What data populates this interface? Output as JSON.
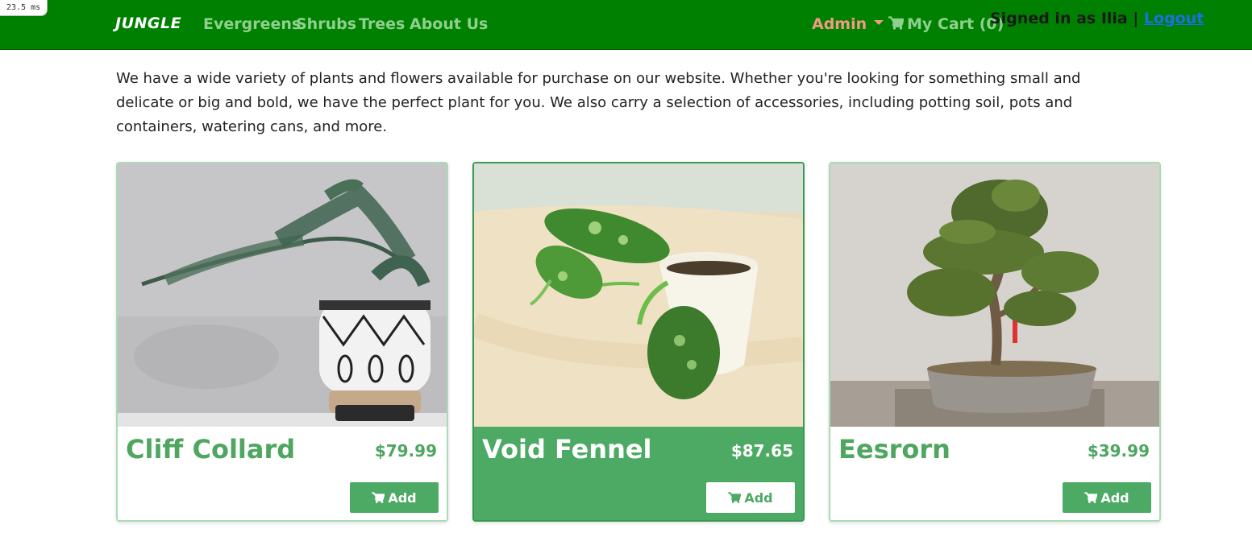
{
  "timing": "23.5 ms",
  "navbar": {
    "brand": "JUNGLE",
    "links": [
      "Evergreens",
      "Shrubs",
      "Trees",
      "About Us"
    ],
    "admin": "Admin",
    "cart": "My Cart (0)",
    "signed_in": "Signed in as Ilia | ",
    "logout": "Logout"
  },
  "intro": "We have a wide variety of plants and flowers available for purchase on our website. Whether you're looking for something small and delicate or big and bold, we have the perfect plant for you. We also carry a selection of accessories, including potting soil, pots and containers, watering cans, and more.",
  "products": [
    {
      "name": "Cliff Collard",
      "price": "$79.99",
      "add_label": "Add"
    },
    {
      "name": "Void Fennel",
      "price": "$87.65",
      "add_label": "Add"
    },
    {
      "name": "Eesrorn",
      "price": "$39.99",
      "add_label": "Add"
    }
  ],
  "colors": {
    "navbar": "#008000",
    "accent": "#4caa64",
    "admin": "#f29a86",
    "logout": "#1d6ee6"
  }
}
